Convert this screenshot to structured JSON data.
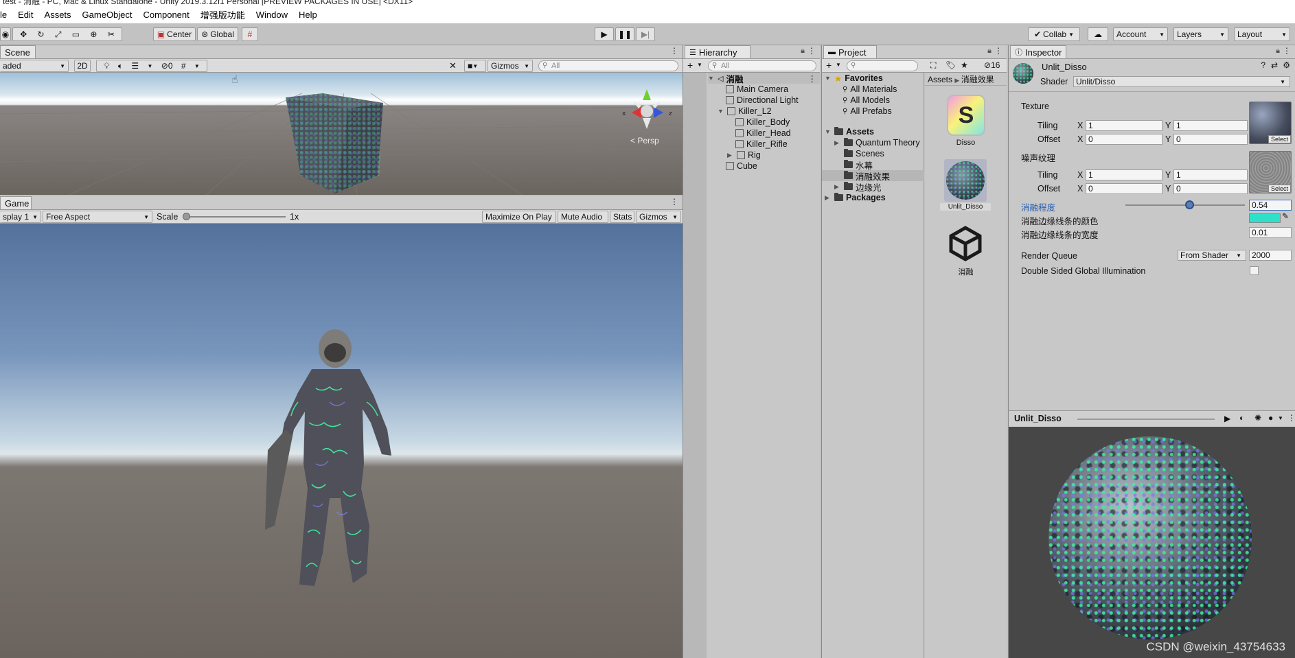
{
  "window": {
    "title": "test - 消融 - PC, Mac & Linux Standalone - Unity 2019.3.12f1 Personal [PREVIEW PACKAGES IN USE] <DX11>"
  },
  "menu": [
    "le",
    "Edit",
    "Assets",
    "GameObject",
    "Component",
    "增强版功能",
    "Window",
    "Help"
  ],
  "toolbar": {
    "pivot": "Center",
    "space": "Global",
    "collab": "Collab",
    "account": "Account",
    "layers": "Layers",
    "layout": "Layout"
  },
  "scene": {
    "tab": "Scene",
    "shading": "aded",
    "mode2d": "2D",
    "hidden_count": "0",
    "gizmos": "Gizmos",
    "search_placeholder": "All",
    "persp": "< Persp"
  },
  "game": {
    "tab": "Game",
    "display": "splay 1",
    "aspect": "Free Aspect",
    "scale_label": "Scale",
    "scale_value": "1x",
    "maximize": "Maximize On Play",
    "mute": "Mute Audio",
    "stats": "Stats",
    "gizmos": "Gizmos"
  },
  "hierarchy": {
    "tab": "Hierarchy",
    "search_placeholder": "All",
    "scene_name": "消融",
    "items": [
      "Main Camera",
      "Directional Light",
      "Killer_L2",
      "Killer_Body",
      "Killer_Head",
      "Killer_Rifle",
      "Rig",
      "Cube"
    ]
  },
  "project": {
    "tab": "Project",
    "hidden_count": "16",
    "favorites_label": "Favorites",
    "favorites": [
      "All Materials",
      "All Models",
      "All Prefabs"
    ],
    "assets_label": "Assets",
    "folders": [
      "Quantum Theory",
      "Scenes",
      "水幕",
      "消融效果",
      "边缘光"
    ],
    "packages_label": "Packages",
    "breadcrumb": [
      "Assets",
      "消融效果"
    ],
    "files": [
      {
        "name": "Disso"
      },
      {
        "name": "Unlit_Disso"
      },
      {
        "name": "消融"
      }
    ]
  },
  "inspector": {
    "tab": "Inspector",
    "material_name": "Unlit_Disso",
    "shader_label": "Shader",
    "shader_value": "Unlit/Disso",
    "texture_label": "Texture",
    "noise_label": "噪声纹理",
    "tiling": "Tiling",
    "offset": "Offset",
    "x": "X",
    "y": "Y",
    "tex_tiling": [
      "1",
      "1"
    ],
    "tex_offset": [
      "0",
      "0"
    ],
    "noise_tiling": [
      "1",
      "1"
    ],
    "noise_offset": [
      "0",
      "0"
    ],
    "select": "Select",
    "dissolve_label": "消融程度",
    "dissolve_value": "0.54",
    "dissolve_fraction": 0.54,
    "edge_color_label": "消融边缘线条的颜色",
    "edge_color": "#2fe0c8",
    "edge_width_label": "消融边缘线条的宽度",
    "edge_width_value": "0.01",
    "render_queue_label": "Render Queue",
    "render_queue_mode": "From Shader",
    "render_queue_value": "2000",
    "dsgi_label": "Double Sided Global Illumination"
  },
  "preview": {
    "title": "Unlit_Disso",
    "watermark": "CSDN @weixin_43754633"
  }
}
